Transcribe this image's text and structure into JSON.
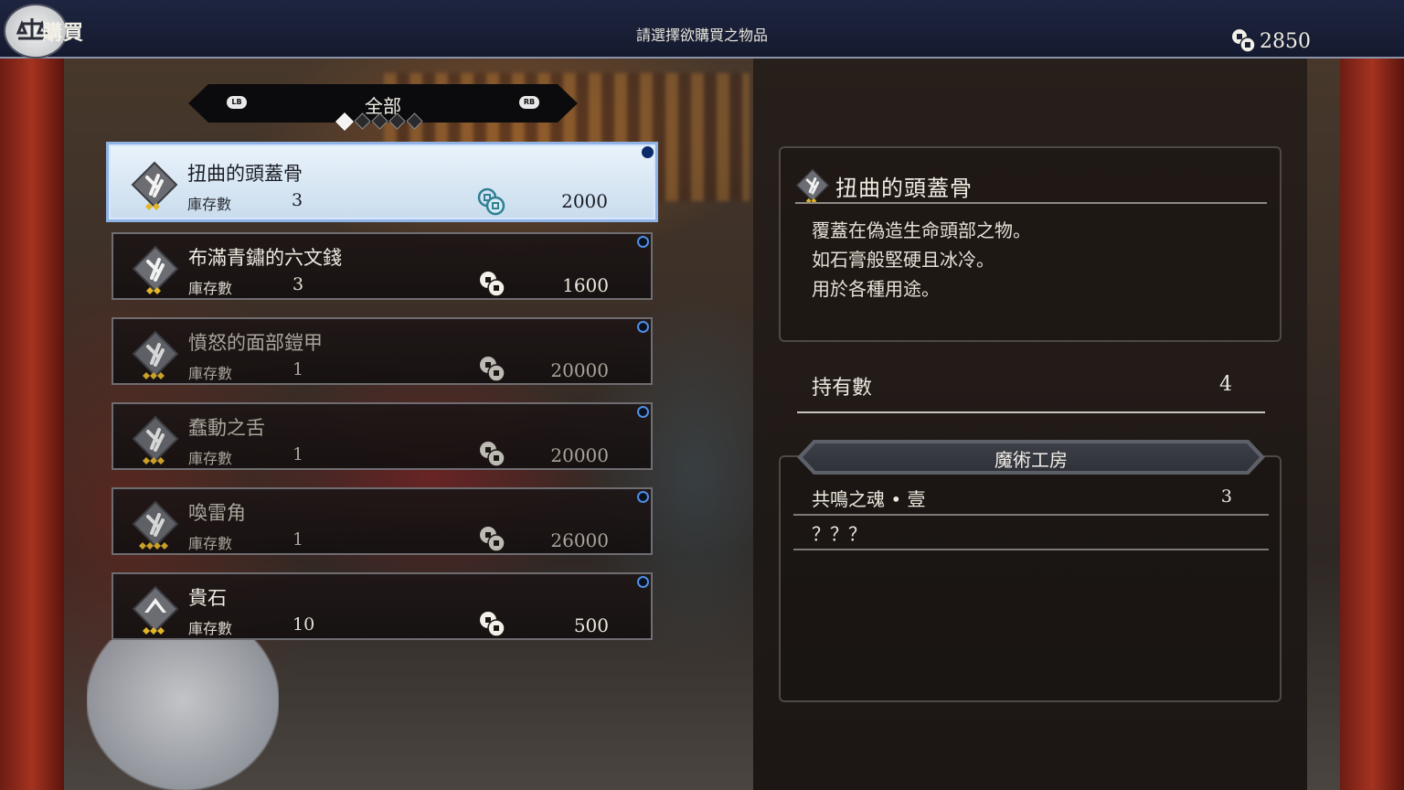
{
  "header": {
    "shop_title": "購買",
    "instruction": "請選擇欲購買之物品",
    "money": "2850"
  },
  "category": {
    "lb": "LB",
    "rb": "RB",
    "label": "全部",
    "pages": 5,
    "active_page": 1
  },
  "items": [
    {
      "name": "扭曲的頭蓋骨",
      "stock_label": "庫存數",
      "stock": "3",
      "price": "2000",
      "icon": "skull-material-icon"
    },
    {
      "name": "布滿青鏽的六文錢",
      "stock_label": "庫存數",
      "stock": "3",
      "price": "1600",
      "icon": "coin-material-icon"
    },
    {
      "name": "憤怒的面部鎧甲",
      "stock_label": "庫存數",
      "stock": "1",
      "price": "20000",
      "icon": "armor-material-icon"
    },
    {
      "name": "蠢動之舌",
      "stock_label": "庫存數",
      "stock": "1",
      "price": "20000",
      "icon": "tongue-material-icon"
    },
    {
      "name": "喚雷角",
      "stock_label": "庫存數",
      "stock": "1",
      "price": "26000",
      "icon": "horn-material-icon"
    },
    {
      "name": "貴石",
      "stock_label": "庫存數",
      "stock": "10",
      "price": "500",
      "icon": "gem-material-icon"
    }
  ],
  "detail": {
    "title": "扭曲的頭蓋骨",
    "desc": [
      "覆蓋在偽造生命頭部之物。",
      "如石膏般堅硬且冰冷。",
      "用於各種用途。"
    ],
    "owned_label": "持有數",
    "owned": "4"
  },
  "workshop": {
    "title": "魔術工房",
    "recipes": [
      {
        "name": "共鳴之魂 • 壹",
        "qty": "3"
      },
      {
        "name": "？？？",
        "qty": ""
      }
    ]
  },
  "colors": {
    "selected_bg": "#eaf3fb",
    "selected_border": "#8fb3e4",
    "new_dot": "#4f8fe6",
    "topbar": "#1e2540"
  }
}
